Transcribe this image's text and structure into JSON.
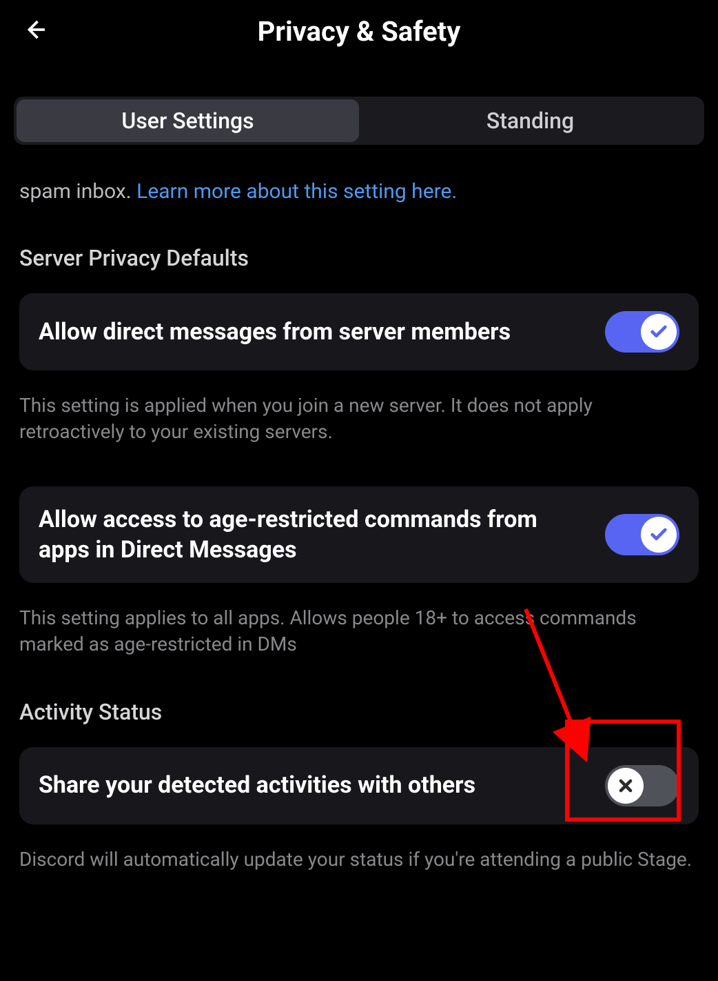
{
  "header": {
    "title": "Privacy & Safety"
  },
  "tabs": {
    "items": [
      {
        "label": "User Settings",
        "active": true
      },
      {
        "label": "Standing",
        "active": false
      }
    ]
  },
  "spam_block": {
    "prefix": "spam inbox. ",
    "link_text": "Learn more about this setting here."
  },
  "section1": {
    "title": "Server Privacy Defaults"
  },
  "setting_dm": {
    "title": "Allow direct messages from server members",
    "description": "This setting is applied when you join a new server. It does not apply retroactively to your existing servers.",
    "enabled": true
  },
  "setting_age": {
    "title": "Allow access to age-restricted commands from apps in Direct Messages",
    "description": "This setting applies to all apps. Allows people 18+ to access commands marked as age-restricted in DMs",
    "enabled": true
  },
  "section2": {
    "title": "Activity Status"
  },
  "setting_activity": {
    "title": "Share your detected activities with others",
    "description": "Discord will automatically update your status if you're attending a public Stage.",
    "enabled": false
  },
  "annotation": {
    "color": "#ff0000"
  }
}
